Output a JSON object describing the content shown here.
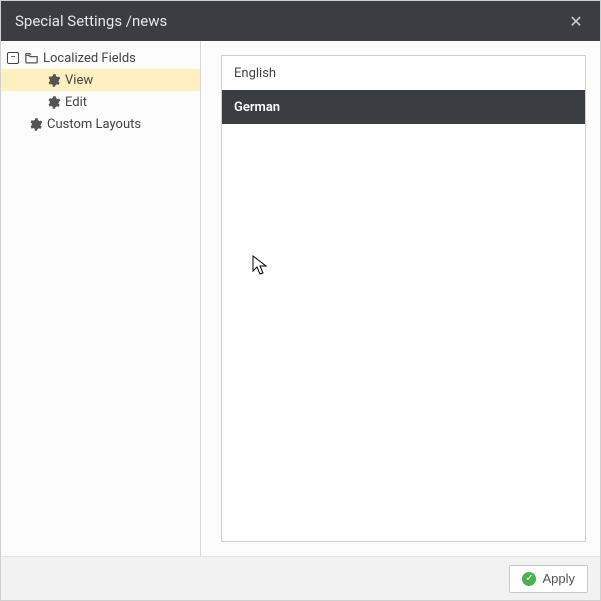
{
  "header": {
    "title": "Special Settings /news"
  },
  "tree": {
    "root_localized": "Localized Fields",
    "view": "View",
    "edit": "Edit",
    "root_custom": "Custom Layouts"
  },
  "languages": {
    "items": [
      "English",
      "German"
    ],
    "selected_index": 1
  },
  "footer": {
    "apply_label": "Apply"
  }
}
